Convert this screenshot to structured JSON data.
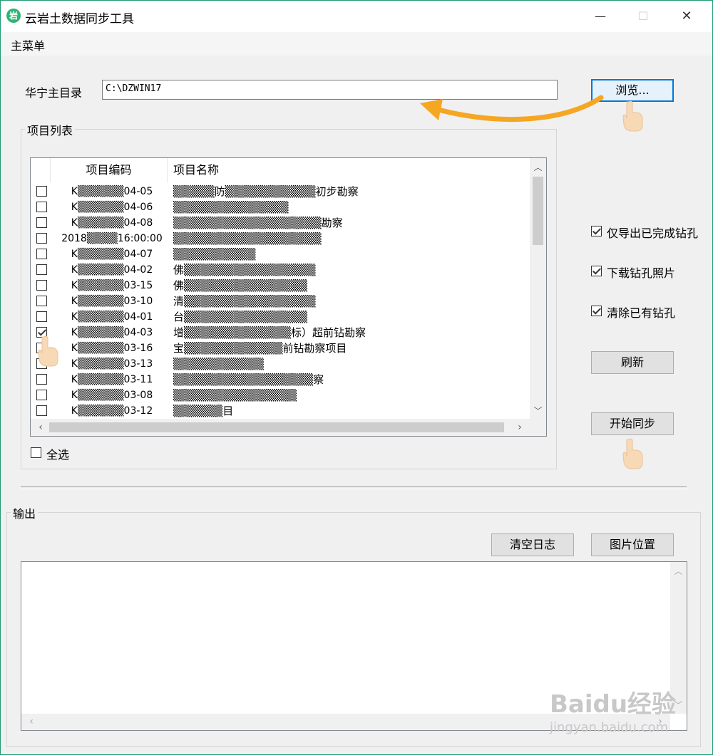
{
  "window": {
    "title": "云岩土数据同步工具",
    "icon_text": "岩",
    "minimize": "—",
    "maximize": "☐",
    "close": "✕"
  },
  "menu": {
    "main": "主菜单"
  },
  "home_dir": {
    "label": "华宁主目录",
    "value": "C:\\DZWIN17",
    "browse_label": "浏览..."
  },
  "project_list": {
    "title": "项目列表",
    "columns": [
      "项目编码",
      "项目名称"
    ],
    "rows": [
      {
        "checked": false,
        "code": "K▒▒▒▒▒▒04-05",
        "name": "▒▒▒▒▒防▒▒▒▒▒▒▒▒▒▒▒初步勘察"
      },
      {
        "checked": false,
        "code": "K▒▒▒▒▒▒04-06",
        "name": "▒▒▒▒▒▒▒▒▒▒▒▒▒▒"
      },
      {
        "checked": false,
        "code": "K▒▒▒▒▒▒04-08",
        "name": "▒▒▒▒▒▒▒▒▒▒▒▒▒▒▒▒▒▒勘察"
      },
      {
        "checked": false,
        "code": "2018▒▒▒▒16:00:00",
        "name": "▒▒▒▒▒▒▒▒▒▒▒▒▒▒▒▒▒▒"
      },
      {
        "checked": false,
        "code": "K▒▒▒▒▒▒04-07",
        "name": "▒▒▒▒▒▒▒▒▒▒"
      },
      {
        "checked": false,
        "code": "K▒▒▒▒▒▒04-02",
        "name": "佛▒▒▒▒▒▒▒▒▒▒▒▒▒▒▒▒"
      },
      {
        "checked": false,
        "code": "K▒▒▒▒▒▒03-15",
        "name": "佛▒▒▒▒▒▒▒▒▒▒▒▒▒▒▒"
      },
      {
        "checked": false,
        "code": "K▒▒▒▒▒▒03-10",
        "name": "清▒▒▒▒▒▒▒▒▒▒▒▒▒▒▒▒"
      },
      {
        "checked": false,
        "code": "K▒▒▒▒▒▒04-01",
        "name": "台▒▒▒▒▒▒▒▒▒▒▒▒▒▒▒"
      },
      {
        "checked": true,
        "code": "K▒▒▒▒▒▒04-03",
        "name": "增▒▒▒▒▒▒▒▒▒▒▒▒▒标）超前钻勘察"
      },
      {
        "checked": false,
        "code": "K▒▒▒▒▒▒03-16",
        "name": "宝▒▒▒▒▒▒▒▒▒▒▒▒前钻勘察项目"
      },
      {
        "checked": false,
        "code": "K▒▒▒▒▒▒03-13",
        "name": "▒▒▒▒▒▒▒▒▒▒▒"
      },
      {
        "checked": false,
        "code": "K▒▒▒▒▒▒03-11",
        "name": "▒▒▒▒▒▒▒▒▒▒▒▒▒▒▒▒▒察"
      },
      {
        "checked": false,
        "code": "K▒▒▒▒▒▒03-08",
        "name": "▒▒▒▒▒▒▒▒▒▒▒▒▒▒▒"
      },
      {
        "checked": false,
        "code": "K▒▒▒▒▒▒03-12",
        "name": "▒▒▒▒▒▒目"
      }
    ],
    "select_all": "全选"
  },
  "options": {
    "export_completed": {
      "label": "仅导出已完成钻孔",
      "checked": true
    },
    "download_photos": {
      "label": "下载钻孔照片",
      "checked": true
    },
    "clear_existing": {
      "label": "清除已有钻孔",
      "checked": true
    }
  },
  "buttons": {
    "refresh": "刷新",
    "start_sync": "开始同步",
    "clear_log": "清空日志",
    "image_location": "图片位置"
  },
  "output": {
    "title": "输出"
  },
  "watermark": {
    "brand": "Baidu经验",
    "url": "jingyan.baidu.com"
  },
  "colors": {
    "accent": "#0078d7",
    "arrow": "#f5a623",
    "app_icon": "#2bb673"
  }
}
